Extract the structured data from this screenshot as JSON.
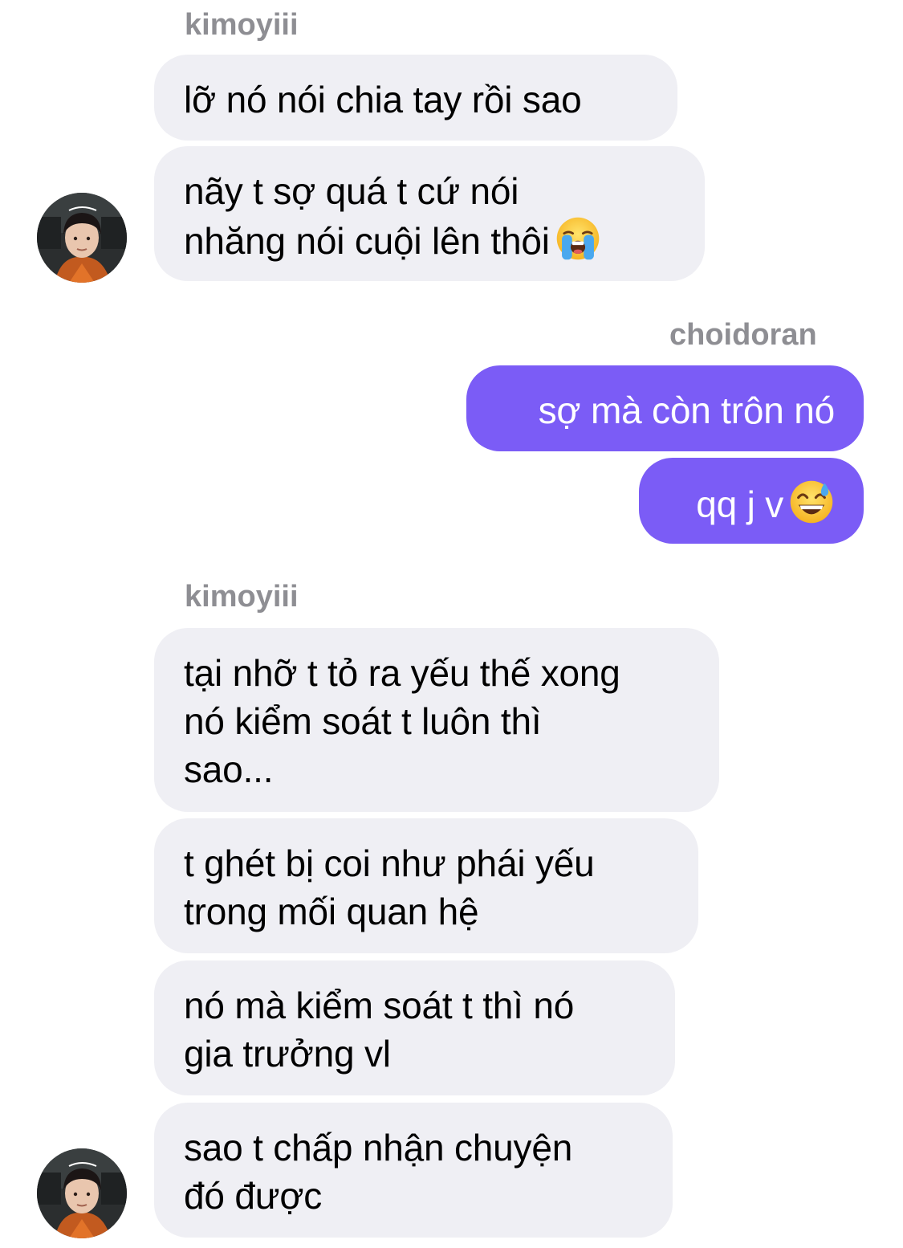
{
  "chat": {
    "block1": {
      "sender": "kimoyiii",
      "messages": [
        {
          "lines": [
            "lỡ nó nói chia tay rồi sao"
          ]
        },
        {
          "lines": [
            "nãy t sợ quá t cứ nói",
            "nhăng nói cuội lên thôi"
          ],
          "emoji": "loudly-crying-face-emoji"
        }
      ]
    },
    "block2": {
      "sender": "choidoran",
      "messages": [
        {
          "lines": [
            "sợ mà còn trôn nó"
          ]
        },
        {
          "lines": [
            "qq j v"
          ],
          "emoji": "grinning-sweat-face-emoji"
        }
      ]
    },
    "block3": {
      "sender": "kimoyiii",
      "messages": [
        {
          "lines": [
            "tại nhỡ t tỏ ra yếu thế xong",
            "nó kiểm soát t luôn thì",
            "sao..."
          ]
        },
        {
          "lines": [
            "t ghét bị coi như phái yếu",
            "trong mối quan hệ"
          ]
        },
        {
          "lines": [
            "nó mà kiểm soát t thì nó",
            "gia trưởng vl"
          ]
        },
        {
          "lines": [
            "sao t chấp nhận chuyện",
            "đó được"
          ]
        }
      ]
    }
  },
  "colors": {
    "incoming_bubble": "#efeff4",
    "outgoing_bubble": "#7b5cf6",
    "sender_name": "#8e8e93"
  },
  "icons": {
    "avatar": "user-avatar-photo"
  }
}
